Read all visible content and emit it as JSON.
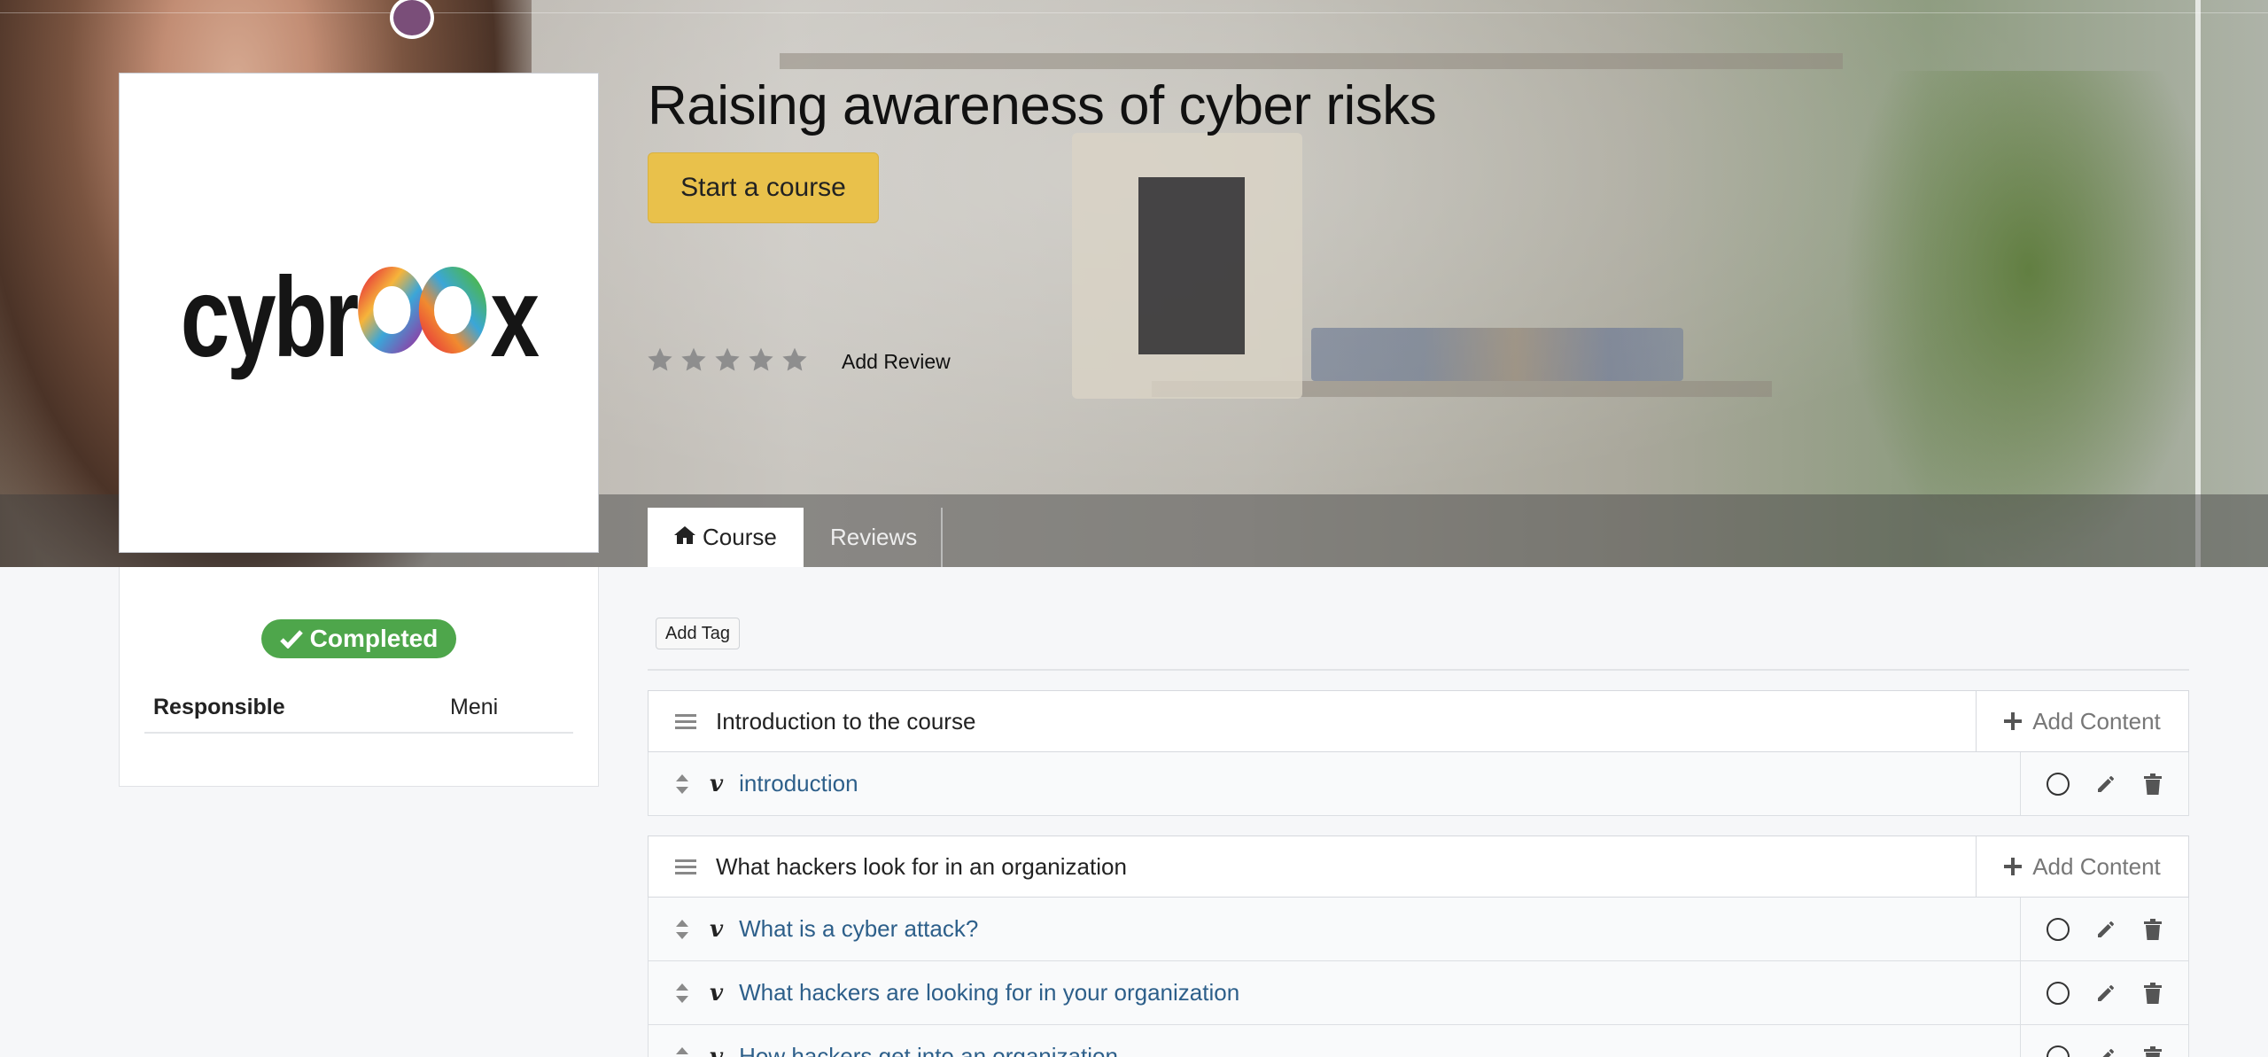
{
  "course": {
    "title": "Raising awareness of cyber risks",
    "start_label": "Start a course",
    "rating_stars": 5,
    "rating_value": 0,
    "add_review_label": "Add Review",
    "logo_text_before": "cybr",
    "logo_text_after": "x"
  },
  "tabs": [
    {
      "label": "Course",
      "icon": "home-icon",
      "active": true
    },
    {
      "label": "Reviews",
      "active": false
    }
  ],
  "status": {
    "badge_label": "Completed",
    "badge_color": "#4ea64b",
    "responsible_label": "Responsible",
    "responsible_value": "Meni"
  },
  "toolbar": {
    "add_tag_label": "Add Tag"
  },
  "sections": [
    {
      "title": "Introduction to the course",
      "add_content_label": "Add Content",
      "items": [
        {
          "title": "introduction",
          "type_icon": "vimeo-icon"
        }
      ]
    },
    {
      "title": "What hackers look for in an organization",
      "add_content_label": "Add Content",
      "items": [
        {
          "title": "What is a cyber attack?",
          "type_icon": "vimeo-icon"
        },
        {
          "title": "What hackers are looking for in your organization",
          "type_icon": "vimeo-icon"
        },
        {
          "title": "How hackers get into an organization",
          "type_icon": "vimeo-icon"
        }
      ]
    }
  ],
  "colors": {
    "accent_button": "#e9c14b",
    "link": "#2d5f8a",
    "completed": "#4ea64b"
  }
}
